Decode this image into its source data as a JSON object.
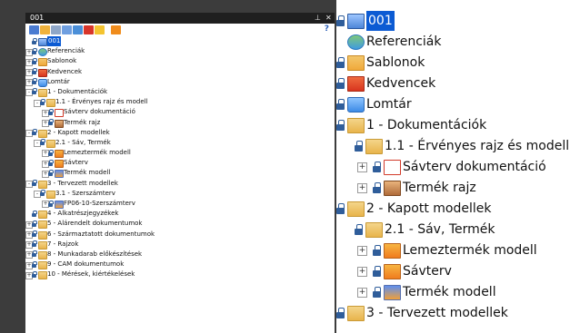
{
  "window": {
    "title": "001"
  },
  "toolbar": {
    "help": "?"
  },
  "tree": [
    {
      "label": "001",
      "depth": 0,
      "expander": "none",
      "icon": "document-icon",
      "selected": true
    },
    {
      "label": "Referenciák",
      "depth": 0,
      "expander": "+",
      "icon": "reference-icon"
    },
    {
      "label": "Sablonok",
      "depth": 0,
      "expander": "+",
      "icon": "template-folder-icon"
    },
    {
      "label": "Kedvencek",
      "depth": 0,
      "expander": "+",
      "icon": "favorites-icon"
    },
    {
      "label": "Lomtár",
      "depth": 0,
      "expander": "+",
      "icon": "trash-icon"
    },
    {
      "label": "1 - Dokumentációk",
      "depth": 0,
      "expander": "-",
      "icon": "folder-icon"
    },
    {
      "label": "1.1 - Érvényes rajz és modell",
      "depth": 1,
      "expander": "-",
      "icon": "folder-icon"
    },
    {
      "label": "Sávterv dokumentáció",
      "depth": 2,
      "expander": "+",
      "icon": "pdf-icon"
    },
    {
      "label": "Termék rajz",
      "depth": 2,
      "expander": "+",
      "icon": "drawing-icon"
    },
    {
      "label": "2 - Kapott modellek",
      "depth": 0,
      "expander": "-",
      "icon": "folder-icon"
    },
    {
      "label": "2.1 - Sáv, Termék",
      "depth": 1,
      "expander": "-",
      "icon": "folder-icon"
    },
    {
      "label": "Lemeztermék modell",
      "depth": 2,
      "expander": "+",
      "icon": "sheetmetal-part-icon"
    },
    {
      "label": "Sávterv",
      "depth": 2,
      "expander": "+",
      "icon": "strip-layout-icon"
    },
    {
      "label": "Termék modell",
      "depth": 2,
      "expander": "+",
      "icon": "assembly-icon"
    },
    {
      "label": "3 - Tervezett modellek",
      "depth": 0,
      "expander": "-",
      "icon": "folder-icon"
    },
    {
      "label": "3.1 - Szerszámterv",
      "depth": 1,
      "expander": "-",
      "icon": "folder-icon"
    },
    {
      "label": "FP06-10-Szerszámterv",
      "depth": 2,
      "expander": "+",
      "icon": "tool-assembly-icon"
    },
    {
      "label": "4 - Alkatrészjegyzékek",
      "depth": 0,
      "expander": "none",
      "icon": "folder-icon"
    },
    {
      "label": "5 - Alárendelt dokumentumok",
      "depth": 0,
      "expander": "+",
      "icon": "folder-icon"
    },
    {
      "label": "6 - Származtatott dokumentumok",
      "depth": 0,
      "expander": "+",
      "icon": "folder-icon"
    },
    {
      "label": "7 - Rajzok",
      "depth": 0,
      "expander": "+",
      "icon": "folder-icon"
    },
    {
      "label": "8 - Munkadarab előkészítések",
      "depth": 0,
      "expander": "+",
      "icon": "folder-icon"
    },
    {
      "label": "9 - CAM dokumentumok",
      "depth": 0,
      "expander": "+",
      "icon": "folder-icon"
    },
    {
      "label": "10 - Mérések, kiértékelések",
      "depth": 0,
      "expander": "+",
      "icon": "folder-icon"
    }
  ],
  "zoom_tree": [
    {
      "label": "001",
      "depth": 0,
      "expander": "none",
      "icon": "document-icon",
      "selected": true
    },
    {
      "label": "Referenciák",
      "depth": 0,
      "expander": "none",
      "icon": "reference-icon",
      "nolock": true
    },
    {
      "label": "Sablonok",
      "depth": 0,
      "expander": "none",
      "icon": "template-folder-icon"
    },
    {
      "label": "Kedvencek",
      "depth": 0,
      "expander": "none",
      "icon": "favorites-icon"
    },
    {
      "label": "Lomtár",
      "depth": 0,
      "expander": "none",
      "icon": "trash-icon"
    },
    {
      "label": "1 - Dokumentációk",
      "depth": 0,
      "expander": "none",
      "icon": "folder-icon"
    },
    {
      "label": "1.1 - Érvényes rajz és modell",
      "depth": 1,
      "expander": "none",
      "icon": "folder-icon"
    },
    {
      "label": "Sávterv dokumentáció",
      "depth": 2,
      "expander": "+",
      "icon": "pdf-icon"
    },
    {
      "label": "Termék rajz",
      "depth": 2,
      "expander": "+",
      "icon": "drawing-icon"
    },
    {
      "label": "2 - Kapott modellek",
      "depth": 0,
      "expander": "none",
      "icon": "folder-icon"
    },
    {
      "label": "2.1 - Sáv, Termék",
      "depth": 1,
      "expander": "none",
      "icon": "folder-icon"
    },
    {
      "label": "Lemeztermék modell",
      "depth": 2,
      "expander": "+",
      "icon": "sheetmetal-part-icon"
    },
    {
      "label": "Sávterv",
      "depth": 2,
      "expander": "+",
      "icon": "strip-layout-icon"
    },
    {
      "label": "Termék modell",
      "depth": 2,
      "expander": "+",
      "icon": "assembly-icon"
    },
    {
      "label": "3 - Tervezett modellek",
      "depth": 0,
      "expander": "none",
      "icon": "folder-icon"
    }
  ],
  "colors": {
    "selection": "#0c5bd3",
    "background": "#3c3c3c",
    "titlebar": "#1f1f1f"
  }
}
